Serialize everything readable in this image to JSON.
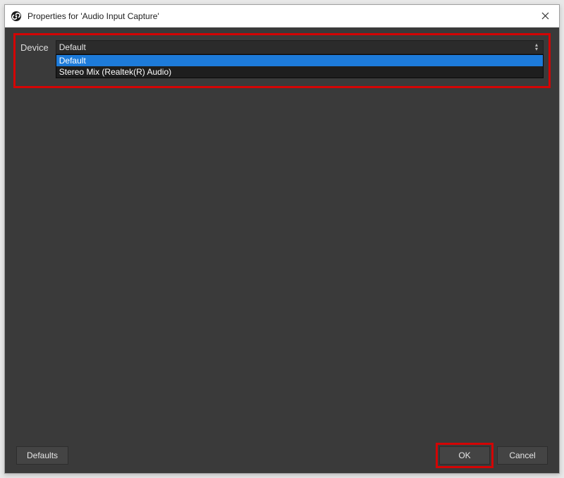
{
  "window": {
    "title": "Properties for 'Audio Input Capture'"
  },
  "device": {
    "label": "Device",
    "selected": "Default",
    "options": [
      "Default",
      "Stereo Mix (Realtek(R) Audio)"
    ]
  },
  "buttons": {
    "defaults": "Defaults",
    "ok": "OK",
    "cancel": "Cancel"
  }
}
